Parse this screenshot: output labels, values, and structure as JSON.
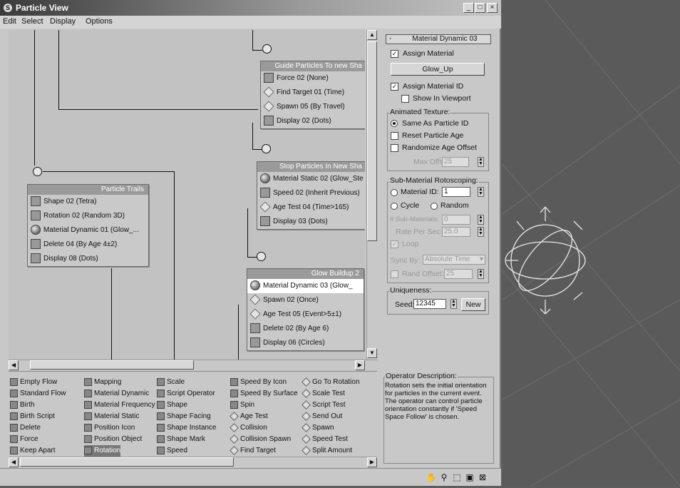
{
  "window": {
    "title": "Particle View",
    "min": "_",
    "max": "□",
    "close": "×"
  },
  "menu": [
    "Edit",
    "Select",
    "Display",
    "Options"
  ],
  "nodes": {
    "guide": {
      "title": "Guide Particles To new Sha",
      "rows": [
        "Force 02 (None)",
        "Find Target 01 (Time)",
        "Spawn 05 (By Travel)",
        "Display 02 (Dots)"
      ]
    },
    "stop": {
      "title": "Stop Particles In New Sha",
      "rows": [
        "Material Static 02 (Glow_Ste",
        "Speed 02 (Inherit Previous)",
        "Age Test 04 (Time>165)",
        "Display 03 (Dots)"
      ]
    },
    "trails": {
      "title": "Particle Trails",
      "rows": [
        "Shape 02 (Tetra)",
        "Rotation 02 (Random 3D)",
        "Material Dynamic 01 (Glow_...",
        "Delete 04 (By Age 4±2)",
        "Display 08 (Dots)"
      ]
    },
    "glow": {
      "title": "Glow Buildup 2",
      "rows": [
        "Material Dynamic 03 (Glow_",
        "Spawn 02 (Once)",
        "Age Test 05 (Event>5±1)",
        "Delete 02 (By Age 6)",
        "Display 06 (Circles)"
      ]
    }
  },
  "rollout": {
    "header": "Material Dynamic 03",
    "collapse": "-",
    "assign_material": "Assign Material",
    "material_button": "Glow_Up",
    "assign_material_id": "Assign Material ID",
    "show_in_viewport": "Show In Viewport",
    "animated_texture": "Animated Texture:",
    "same_as_particle_id": "Same As Particle ID",
    "reset_particle_age": "Reset Particle Age",
    "randomize_age_offset": "Randomize Age Offset",
    "max_offset_label": "Max Offset:",
    "max_offset_value": "25",
    "sub_material": "Sub-Material Rotoscoping:",
    "material_id_label": "Material ID:",
    "material_id_value": "1",
    "cycle": "Cycle",
    "random": "Random",
    "num_sub_label": "# Sub-Materials:",
    "num_sub_value": "0",
    "rate_label": "Rate Per Sec:",
    "rate_value": "25.0",
    "loop": "Loop",
    "sync_label": "Sync By:",
    "sync_value": "Absolute Time",
    "rand_offset_label": "Rand Offset:",
    "rand_offset_value": "25",
    "uniqueness": "Uniqueness:",
    "seed_label": "Seed:",
    "seed_value": "12345",
    "new_button": "New"
  },
  "depot": [
    [
      "Empty Flow",
      "Standard Flow",
      "Birth",
      "Birth Script",
      "Delete",
      "Force",
      "Keep Apart"
    ],
    [
      "Mapping",
      "Material Dynamic",
      "Material Frequency",
      "Material Static",
      "Position Icon",
      "Position Object",
      "Rotation"
    ],
    [
      "Scale",
      "Script Operator",
      "Shape",
      "Shape Facing",
      "Shape Instance",
      "Shape Mark",
      "Speed"
    ],
    [
      "Speed By Icon",
      "Speed By Surface",
      "Spin",
      "Age Test",
      "Collision",
      "Collision Spawn",
      "Find Target"
    ],
    [
      "Go To Rotation",
      "Scale Test",
      "Script Test",
      "Send Out",
      "Spawn",
      "Speed Test",
      "Split Amount"
    ]
  ],
  "description": {
    "label": "Operator Description:",
    "text": "Rotation sets the initial orientation for particles in the current event. The operator can control particle orientation constantly if 'Speed Space Follow' is chosen."
  },
  "status_tools": [
    "hand-pan",
    "zoom",
    "zoom-region",
    "zoom-extents",
    "no-zoom"
  ]
}
